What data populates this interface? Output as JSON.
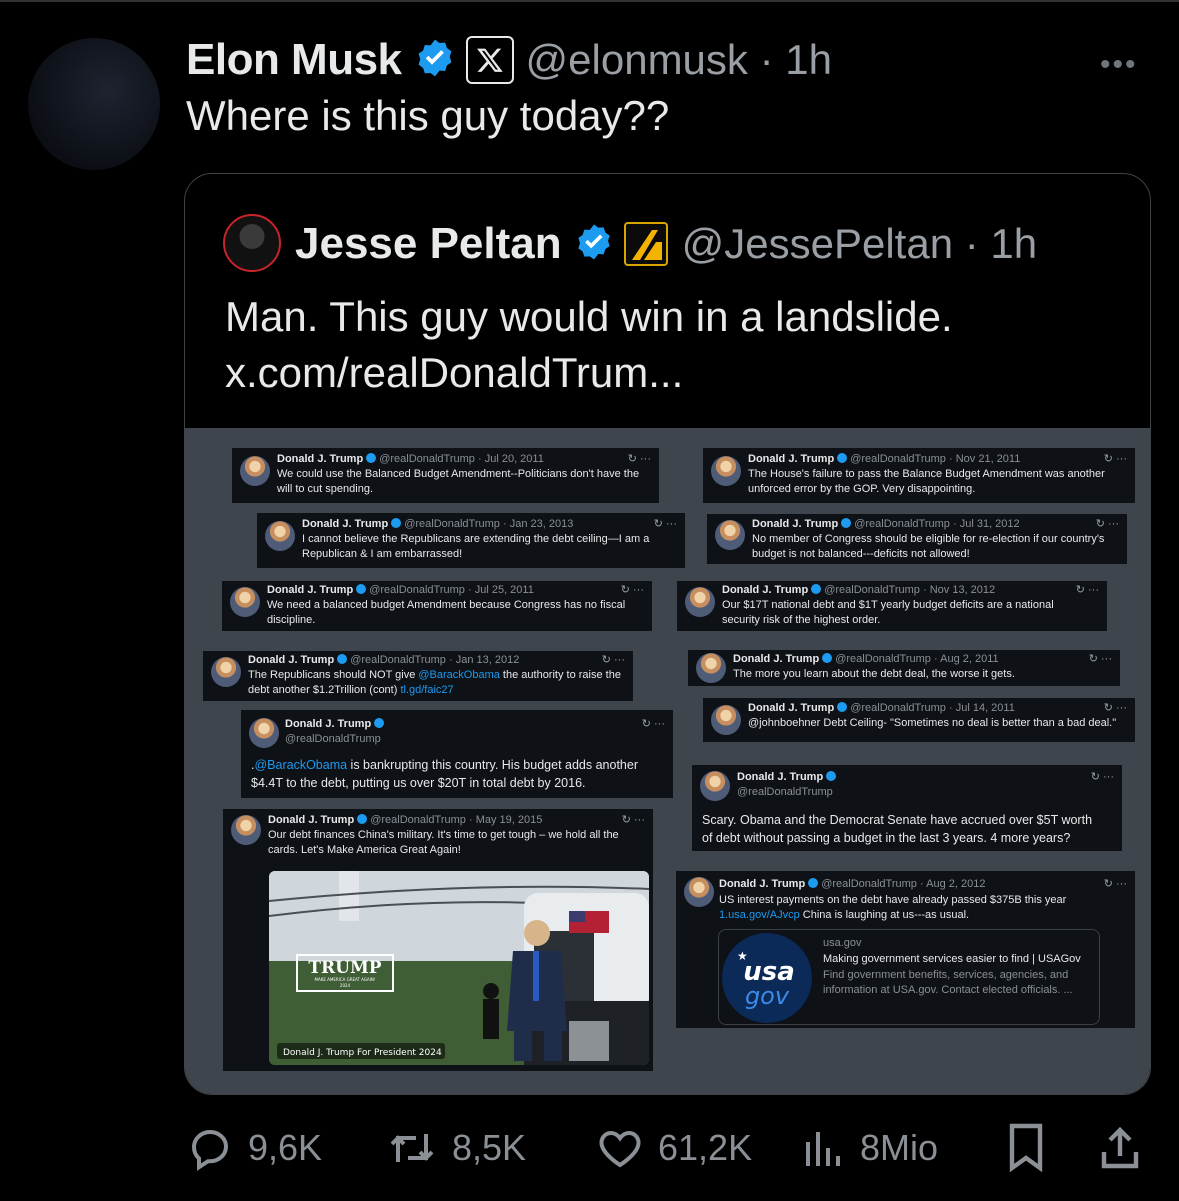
{
  "post": {
    "author_name": "Elon Musk",
    "author_handle": "@elonmusk",
    "time_sep": "·",
    "time": "1h",
    "text": "Where is this guy today??",
    "more": "•••"
  },
  "quote": {
    "author_name": "Jesse Peltan",
    "author_handle": "@JessePeltan",
    "time_sep": "·",
    "time": "1h",
    "text_line1": "Man. This guy would win in a landslide.",
    "text_line2": "x.com/realDonaldTrum..."
  },
  "media_tweets": [
    {
      "name": "Donald J. Trump",
      "handle": "@realDonaldTrump",
      "date": "Jul 20, 2011",
      "lines": [
        "We could use the Balanced Budget Amendment--Politicians don't have the",
        "will to cut spending."
      ]
    },
    {
      "name": "Donald J. Trump",
      "handle": "@realDonaldTrump",
      "date": "Jan 23, 2013",
      "lines": [
        "I cannot believe the Republicans are extending the debt ceiling—I am a",
        "Republican & I am embarrassed!"
      ]
    },
    {
      "name": "Donald J. Trump",
      "handle": "@realDonaldTrump",
      "date": "Jul 25, 2011",
      "lines": [
        "We need a balanced budget Amendment because Congress has no fiscal",
        "discipline."
      ]
    },
    {
      "name": "Donald J. Trump",
      "handle": "@realDonaldTrump",
      "date": "Jan 13, 2012",
      "line1_pre": "The Republicans should NOT give ",
      "line1_link": "@BarackObama",
      "line1_post": " the authority to raise the",
      "line2_pre": "debt another $1.2Trillion (cont) ",
      "line2_link": "tl.gd/faic27"
    },
    {
      "name": "Donald J. Trump",
      "handle": "@realDonaldTrump",
      "line1_pre": ".",
      "line1_link": "@BarackObama",
      "line1_post": " is bankrupting this country. His budget adds another",
      "line2": "$4.4T to the debt, putting us over $20T in total debt by 2016."
    },
    {
      "name": "Donald J. Trump",
      "handle": "@realDonaldTrump",
      "date": "May 19, 2015",
      "lines": [
        "Our debt finances China's military. It's time to get tough – we hold all the",
        "cards. Let's Make America Great Again!"
      ],
      "photo_sign": "TRUMP",
      "photo_sign_sub": "MAKE AMERICA GREAT AGAIN!",
      "photo_sign_year": "2024",
      "photo_caption": "Donald J. Trump For President 2024"
    },
    {
      "name": "Donald J. Trump",
      "handle": "@realDonaldTrump",
      "date": "Nov 21, 2011",
      "lines": [
        "The House's failure to pass the Balance Budget Amendment was another",
        "unforced error by the GOP. Very disappointing."
      ]
    },
    {
      "name": "Donald J. Trump",
      "handle": "@realDonaldTrump",
      "date": "Jul 31, 2012",
      "lines": [
        "No member of Congress should be eligible for re-election if our country's",
        "budget is not balanced---deficits not allowed!"
      ]
    },
    {
      "name": "Donald J. Trump",
      "handle": "@realDonaldTrump",
      "date": "Nov 13, 2012",
      "lines": [
        "Our $17T national debt and $1T yearly budget deficits are a national",
        "security risk of the highest order."
      ]
    },
    {
      "name": "Donald J. Trump",
      "handle": "@realDonaldTrump",
      "date": "Aug 2, 2011",
      "lines": [
        "The more you learn about the debt deal, the worse it gets."
      ]
    },
    {
      "name": "Donald J. Trump",
      "handle": "@realDonaldTrump",
      "date": "Jul 14, 2011",
      "lines": [
        "@johnboehner Debt Ceiling- \"Sometimes no deal is better than a bad deal.\""
      ]
    },
    {
      "name": "Donald J. Trump",
      "handle": "@realDonaldTrump",
      "lines": [
        "Scary.  Obama and the Democrat Senate have accrued over $5T worth",
        "of debt without passing a budget in the last 3 years.  4 more years?"
      ]
    },
    {
      "name": "Donald J. Trump",
      "handle": "@realDonaldTrump",
      "date": "Aug 2, 2012",
      "line1": "US interest payments on the debt have already passed $375B this year",
      "line2_link": "1.usa.gov/AJvcp",
      "line2_post": "  China is laughing at us---as usual.",
      "card_domain": "usa.gov",
      "card_title": "Making government services easier to find | USAGov",
      "card_desc1": "Find government benefits, services, agencies, and",
      "card_desc2": "information at USA.gov. Contact elected officials. ...",
      "card_logo1": "usa",
      "card_logo2": "gov"
    }
  ],
  "media_icons": "↻ ···",
  "actions": {
    "replies": "9,6K",
    "reposts": "8,5K",
    "likes": "61,2K",
    "views": "8Mio"
  },
  "colors": {
    "background": "#000000",
    "text": "#e7e9ea",
    "muted": "#71767b",
    "verified": "#1d9bf0",
    "media_bg": "#3f454d"
  }
}
